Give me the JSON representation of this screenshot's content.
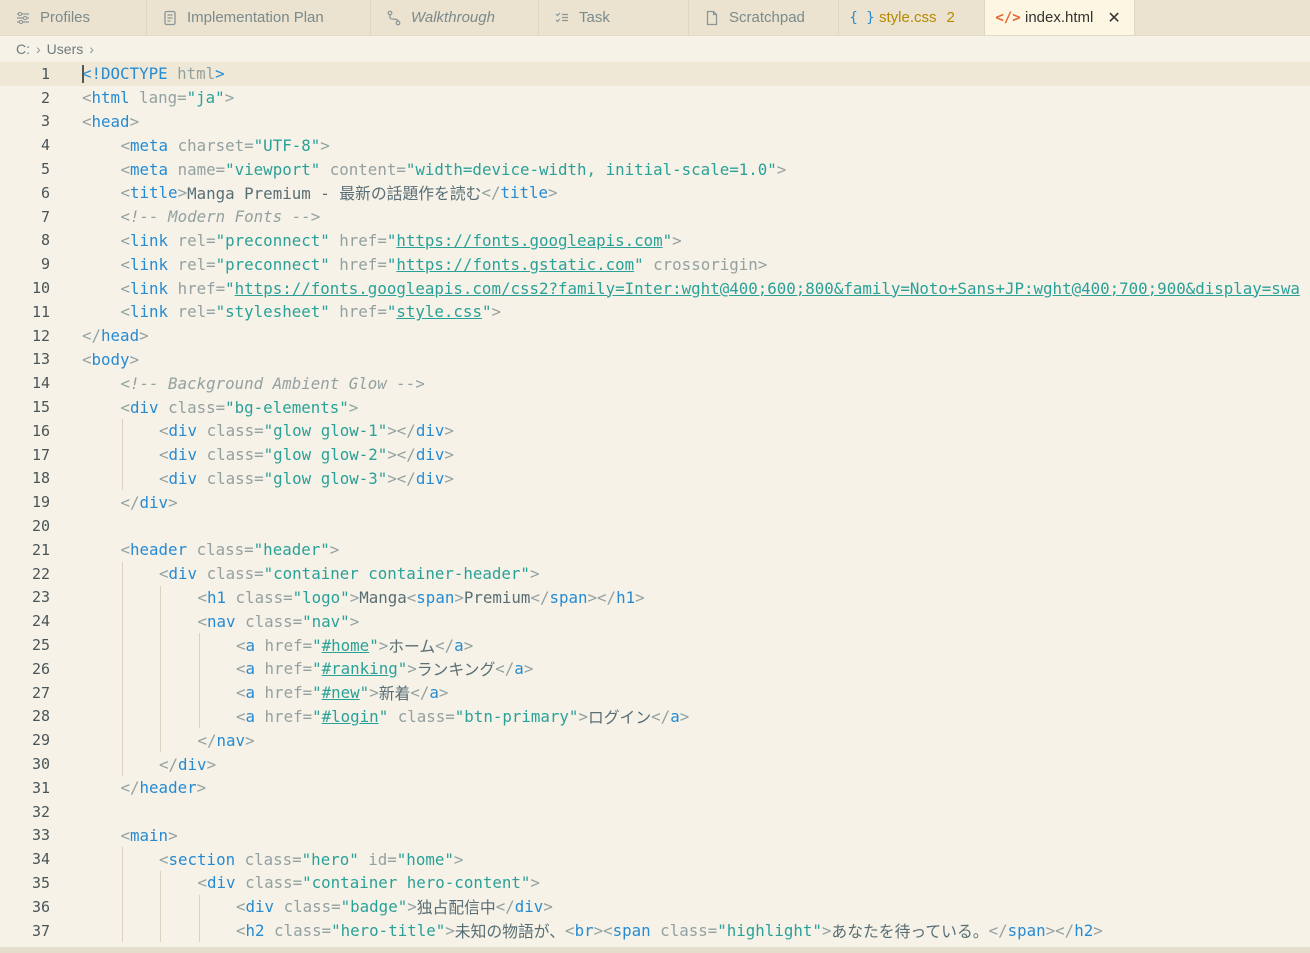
{
  "tabs": [
    {
      "label": "Profiles",
      "icon": "sliders-icon",
      "italic": false
    },
    {
      "label": "Implementation Plan",
      "icon": "document-icon",
      "italic": false
    },
    {
      "label": "Walkthrough",
      "icon": "route-icon",
      "italic": true
    },
    {
      "label": "Task",
      "icon": "checklist-icon",
      "italic": false
    },
    {
      "label": "Scratchpad",
      "icon": "file-icon",
      "italic": false
    },
    {
      "label": "style.css",
      "icon": "braces-icon",
      "italic": false,
      "count": "2"
    },
    {
      "label": "index.html",
      "icon": "code-icon",
      "italic": false,
      "active": true
    }
  ],
  "breadcrumb": [
    "C:",
    "Users"
  ],
  "lines": [
    {
      "n": "1",
      "indent": 0,
      "tokens": [
        [
          "t",
          "<!DOCTYPE"
        ],
        [
          "p",
          " html"
        ],
        [
          "t",
          ">"
        ]
      ]
    },
    {
      "n": "2",
      "indent": 0,
      "tokens": [
        [
          "p",
          "<"
        ],
        [
          "t",
          "html"
        ],
        [
          "a",
          " lang="
        ],
        [
          "s",
          "\"ja\""
        ],
        [
          "p",
          ">"
        ]
      ]
    },
    {
      "n": "3",
      "indent": 0,
      "tokens": [
        [
          "p",
          "<"
        ],
        [
          "t",
          "head"
        ],
        [
          "p",
          ">"
        ]
      ]
    },
    {
      "n": "4",
      "indent": 1,
      "tokens": [
        [
          "p",
          "<"
        ],
        [
          "t",
          "meta"
        ],
        [
          "a",
          " charset="
        ],
        [
          "s",
          "\"UTF-8\""
        ],
        [
          "p",
          ">"
        ]
      ]
    },
    {
      "n": "5",
      "indent": 1,
      "tokens": [
        [
          "p",
          "<"
        ],
        [
          "t",
          "meta"
        ],
        [
          "a",
          " name="
        ],
        [
          "s",
          "\"viewport\""
        ],
        [
          "a",
          " content="
        ],
        [
          "s",
          "\"width=device-width, initial-scale=1.0\""
        ],
        [
          "p",
          ">"
        ]
      ]
    },
    {
      "n": "6",
      "indent": 1,
      "tokens": [
        [
          "p",
          "<"
        ],
        [
          "t",
          "title"
        ],
        [
          "p",
          ">"
        ],
        [
          "x",
          "Manga Premium - 最新の話題作を読む"
        ],
        [
          "p",
          "</"
        ],
        [
          "t",
          "title"
        ],
        [
          "p",
          ">"
        ]
      ]
    },
    {
      "n": "7",
      "indent": 1,
      "tokens": [
        [
          "c",
          "<!-- Modern Fonts -->"
        ]
      ]
    },
    {
      "n": "8",
      "indent": 1,
      "tokens": [
        [
          "p",
          "<"
        ],
        [
          "t",
          "link"
        ],
        [
          "a",
          " rel="
        ],
        [
          "s",
          "\"preconnect\""
        ],
        [
          "a",
          " href="
        ],
        [
          "s",
          "\""
        ],
        [
          "u",
          "https://fonts.googleapis.com"
        ],
        [
          "s",
          "\""
        ],
        [
          "p",
          ">"
        ]
      ]
    },
    {
      "n": "9",
      "indent": 1,
      "tokens": [
        [
          "p",
          "<"
        ],
        [
          "t",
          "link"
        ],
        [
          "a",
          " rel="
        ],
        [
          "s",
          "\"preconnect\""
        ],
        [
          "a",
          " href="
        ],
        [
          "s",
          "\""
        ],
        [
          "u",
          "https://fonts.gstatic.com"
        ],
        [
          "s",
          "\""
        ],
        [
          "a",
          " crossorigin"
        ],
        [
          "p",
          ">"
        ]
      ]
    },
    {
      "n": "10",
      "indent": 1,
      "tokens": [
        [
          "p",
          "<"
        ],
        [
          "t",
          "link"
        ],
        [
          "a",
          " href="
        ],
        [
          "s",
          "\""
        ],
        [
          "u",
          "https://fonts.googleapis.com/css2?family=Inter:wght@400;600;800&family=Noto+Sans+JP:wght@400;700;900&display=swa"
        ]
      ]
    },
    {
      "n": "11",
      "indent": 1,
      "tokens": [
        [
          "p",
          "<"
        ],
        [
          "t",
          "link"
        ],
        [
          "a",
          " rel="
        ],
        [
          "s",
          "\"stylesheet\""
        ],
        [
          "a",
          " href="
        ],
        [
          "s",
          "\""
        ],
        [
          "u",
          "style.css"
        ],
        [
          "s",
          "\""
        ],
        [
          "p",
          ">"
        ]
      ]
    },
    {
      "n": "12",
      "indent": 0,
      "tokens": [
        [
          "p",
          "</"
        ],
        [
          "t",
          "head"
        ],
        [
          "p",
          ">"
        ]
      ]
    },
    {
      "n": "13",
      "indent": 0,
      "tokens": [
        [
          "p",
          "<"
        ],
        [
          "t",
          "body"
        ],
        [
          "p",
          ">"
        ]
      ]
    },
    {
      "n": "14",
      "indent": 1,
      "tokens": [
        [
          "c",
          "<!-- Background Ambient Glow -->"
        ]
      ]
    },
    {
      "n": "15",
      "indent": 1,
      "tokens": [
        [
          "p",
          "<"
        ],
        [
          "t",
          "div"
        ],
        [
          "a",
          " class="
        ],
        [
          "s",
          "\"bg-elements\""
        ],
        [
          "p",
          ">"
        ]
      ]
    },
    {
      "n": "16",
      "indent": 2,
      "tokens": [
        [
          "p",
          "<"
        ],
        [
          "t",
          "div"
        ],
        [
          "a",
          " class="
        ],
        [
          "s",
          "\"glow glow-1\""
        ],
        [
          "p",
          "></"
        ],
        [
          "t",
          "div"
        ],
        [
          "p",
          ">"
        ]
      ]
    },
    {
      "n": "17",
      "indent": 2,
      "tokens": [
        [
          "p",
          "<"
        ],
        [
          "t",
          "div"
        ],
        [
          "a",
          " class="
        ],
        [
          "s",
          "\"glow glow-2\""
        ],
        [
          "p",
          "></"
        ],
        [
          "t",
          "div"
        ],
        [
          "p",
          ">"
        ]
      ]
    },
    {
      "n": "18",
      "indent": 2,
      "tokens": [
        [
          "p",
          "<"
        ],
        [
          "t",
          "div"
        ],
        [
          "a",
          " class="
        ],
        [
          "s",
          "\"glow glow-3\""
        ],
        [
          "p",
          "></"
        ],
        [
          "t",
          "div"
        ],
        [
          "p",
          ">"
        ]
      ]
    },
    {
      "n": "19",
      "indent": 1,
      "tokens": [
        [
          "p",
          "</"
        ],
        [
          "t",
          "div"
        ],
        [
          "p",
          ">"
        ]
      ]
    },
    {
      "n": "20",
      "indent": 0,
      "tokens": []
    },
    {
      "n": "21",
      "indent": 1,
      "tokens": [
        [
          "p",
          "<"
        ],
        [
          "t",
          "header"
        ],
        [
          "a",
          " class="
        ],
        [
          "s",
          "\"header\""
        ],
        [
          "p",
          ">"
        ]
      ]
    },
    {
      "n": "22",
      "indent": 2,
      "tokens": [
        [
          "p",
          "<"
        ],
        [
          "t",
          "div"
        ],
        [
          "a",
          " class="
        ],
        [
          "s",
          "\"container container-header\""
        ],
        [
          "p",
          ">"
        ]
      ]
    },
    {
      "n": "23",
      "indent": 3,
      "tokens": [
        [
          "p",
          "<"
        ],
        [
          "t",
          "h1"
        ],
        [
          "a",
          " class="
        ],
        [
          "s",
          "\"logo\""
        ],
        [
          "p",
          ">"
        ],
        [
          "x",
          "Manga"
        ],
        [
          "p",
          "<"
        ],
        [
          "t",
          "span"
        ],
        [
          "p",
          ">"
        ],
        [
          "x",
          "Premium"
        ],
        [
          "p",
          "</"
        ],
        [
          "t",
          "span"
        ],
        [
          "p",
          "></"
        ],
        [
          "t",
          "h1"
        ],
        [
          "p",
          ">"
        ]
      ]
    },
    {
      "n": "24",
      "indent": 3,
      "tokens": [
        [
          "p",
          "<"
        ],
        [
          "t",
          "nav"
        ],
        [
          "a",
          " class="
        ],
        [
          "s",
          "\"nav\""
        ],
        [
          "p",
          ">"
        ]
      ]
    },
    {
      "n": "25",
      "indent": 4,
      "tokens": [
        [
          "p",
          "<"
        ],
        [
          "t",
          "a"
        ],
        [
          "a",
          " href="
        ],
        [
          "s",
          "\""
        ],
        [
          "u",
          "#home"
        ],
        [
          "s",
          "\""
        ],
        [
          "p",
          ">"
        ],
        [
          "x",
          "ホーム"
        ],
        [
          "p",
          "</"
        ],
        [
          "t",
          "a"
        ],
        [
          "p",
          ">"
        ]
      ]
    },
    {
      "n": "26",
      "indent": 4,
      "tokens": [
        [
          "p",
          "<"
        ],
        [
          "t",
          "a"
        ],
        [
          "a",
          " href="
        ],
        [
          "s",
          "\""
        ],
        [
          "u",
          "#ranking"
        ],
        [
          "s",
          "\""
        ],
        [
          "p",
          ">"
        ],
        [
          "x",
          "ランキング"
        ],
        [
          "p",
          "</"
        ],
        [
          "t",
          "a"
        ],
        [
          "p",
          ">"
        ]
      ]
    },
    {
      "n": "27",
      "indent": 4,
      "tokens": [
        [
          "p",
          "<"
        ],
        [
          "t",
          "a"
        ],
        [
          "a",
          " href="
        ],
        [
          "s",
          "\""
        ],
        [
          "u",
          "#new"
        ],
        [
          "s",
          "\""
        ],
        [
          "p",
          ">"
        ],
        [
          "x",
          "新着"
        ],
        [
          "p",
          "</"
        ],
        [
          "t",
          "a"
        ],
        [
          "p",
          ">"
        ]
      ]
    },
    {
      "n": "28",
      "indent": 4,
      "tokens": [
        [
          "p",
          "<"
        ],
        [
          "t",
          "a"
        ],
        [
          "a",
          " href="
        ],
        [
          "s",
          "\""
        ],
        [
          "u",
          "#login"
        ],
        [
          "s",
          "\""
        ],
        [
          "a",
          " class="
        ],
        [
          "s",
          "\"btn-primary\""
        ],
        [
          "p",
          ">"
        ],
        [
          "x",
          "ログイン"
        ],
        [
          "p",
          "</"
        ],
        [
          "t",
          "a"
        ],
        [
          "p",
          ">"
        ]
      ]
    },
    {
      "n": "29",
      "indent": 3,
      "tokens": [
        [
          "p",
          "</"
        ],
        [
          "t",
          "nav"
        ],
        [
          "p",
          ">"
        ]
      ]
    },
    {
      "n": "30",
      "indent": 2,
      "tokens": [
        [
          "p",
          "</"
        ],
        [
          "t",
          "div"
        ],
        [
          "p",
          ">"
        ]
      ]
    },
    {
      "n": "31",
      "indent": 1,
      "tokens": [
        [
          "p",
          "</"
        ],
        [
          "t",
          "header"
        ],
        [
          "p",
          ">"
        ]
      ]
    },
    {
      "n": "32",
      "indent": 0,
      "tokens": []
    },
    {
      "n": "33",
      "indent": 1,
      "tokens": [
        [
          "p",
          "<"
        ],
        [
          "t",
          "main"
        ],
        [
          "p",
          ">"
        ]
      ]
    },
    {
      "n": "34",
      "indent": 2,
      "tokens": [
        [
          "p",
          "<"
        ],
        [
          "t",
          "section"
        ],
        [
          "a",
          " class="
        ],
        [
          "s",
          "\"hero\""
        ],
        [
          "a",
          " id="
        ],
        [
          "s",
          "\"home\""
        ],
        [
          "p",
          ">"
        ]
      ]
    },
    {
      "n": "35",
      "indent": 3,
      "tokens": [
        [
          "p",
          "<"
        ],
        [
          "t",
          "div"
        ],
        [
          "a",
          " class="
        ],
        [
          "s",
          "\"container hero-content\""
        ],
        [
          "p",
          ">"
        ]
      ]
    },
    {
      "n": "36",
      "indent": 4,
      "tokens": [
        [
          "p",
          "<"
        ],
        [
          "t",
          "div"
        ],
        [
          "a",
          " class="
        ],
        [
          "s",
          "\"badge\""
        ],
        [
          "p",
          ">"
        ],
        [
          "x",
          "独占配信中"
        ],
        [
          "p",
          "</"
        ],
        [
          "t",
          "div"
        ],
        [
          "p",
          ">"
        ]
      ]
    },
    {
      "n": "37",
      "indent": 4,
      "tokens": [
        [
          "p",
          "<"
        ],
        [
          "t",
          "h2"
        ],
        [
          "a",
          " class="
        ],
        [
          "s",
          "\"hero-title\""
        ],
        [
          "p",
          ">"
        ],
        [
          "x",
          "未知の物語が、"
        ],
        [
          "p",
          "<"
        ],
        [
          "t",
          "br"
        ],
        [
          "p",
          "><"
        ],
        [
          "t",
          "span"
        ],
        [
          "a",
          " class="
        ],
        [
          "s",
          "\"highlight\""
        ],
        [
          "p",
          ">"
        ],
        [
          "x",
          "あなたを待っている。"
        ],
        [
          "p",
          "</"
        ],
        [
          "t",
          "span"
        ],
        [
          "p",
          "></"
        ],
        [
          "t",
          "h2"
        ],
        [
          "p",
          ">"
        ]
      ]
    }
  ]
}
